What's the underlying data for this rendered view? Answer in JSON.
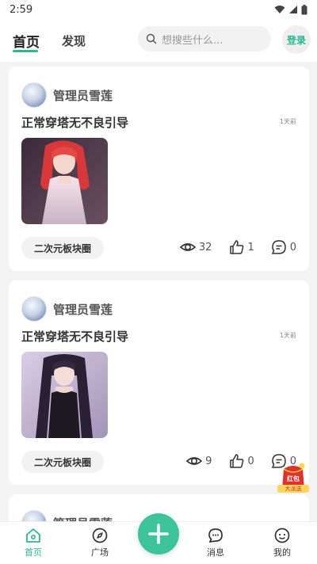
{
  "status_bar": {
    "time": "2:59"
  },
  "header": {
    "tabs": [
      {
        "label": "首页"
      },
      {
        "label": "发现"
      }
    ],
    "search_placeholder": "想搜些什么...",
    "login_label": "登录"
  },
  "posts": [
    {
      "author": "管理员雪莲",
      "title": "正常穿塔无不良引导",
      "time": "1天前",
      "tag": "二次元板块圈",
      "views": "32",
      "likes": "1",
      "comments": "0"
    },
    {
      "author": "管理员雪莲",
      "title": "正常穿塔无不良引导",
      "time": "1天前",
      "tag": "二次元板块圈",
      "views": "9",
      "likes": "0",
      "comments": "0"
    },
    {
      "author": "管理员雪莲"
    }
  ],
  "bottom_nav": {
    "items": [
      {
        "label": "首页"
      },
      {
        "label": "广场"
      },
      {
        "label": "消息"
      },
      {
        "label": "我的"
      }
    ]
  },
  "floating_badge": {
    "title": "红包",
    "subtitle": "大派送"
  },
  "colors": {
    "accent": "#2ab98f",
    "fab": "#3cc39a",
    "background": "#f3f3f3"
  }
}
